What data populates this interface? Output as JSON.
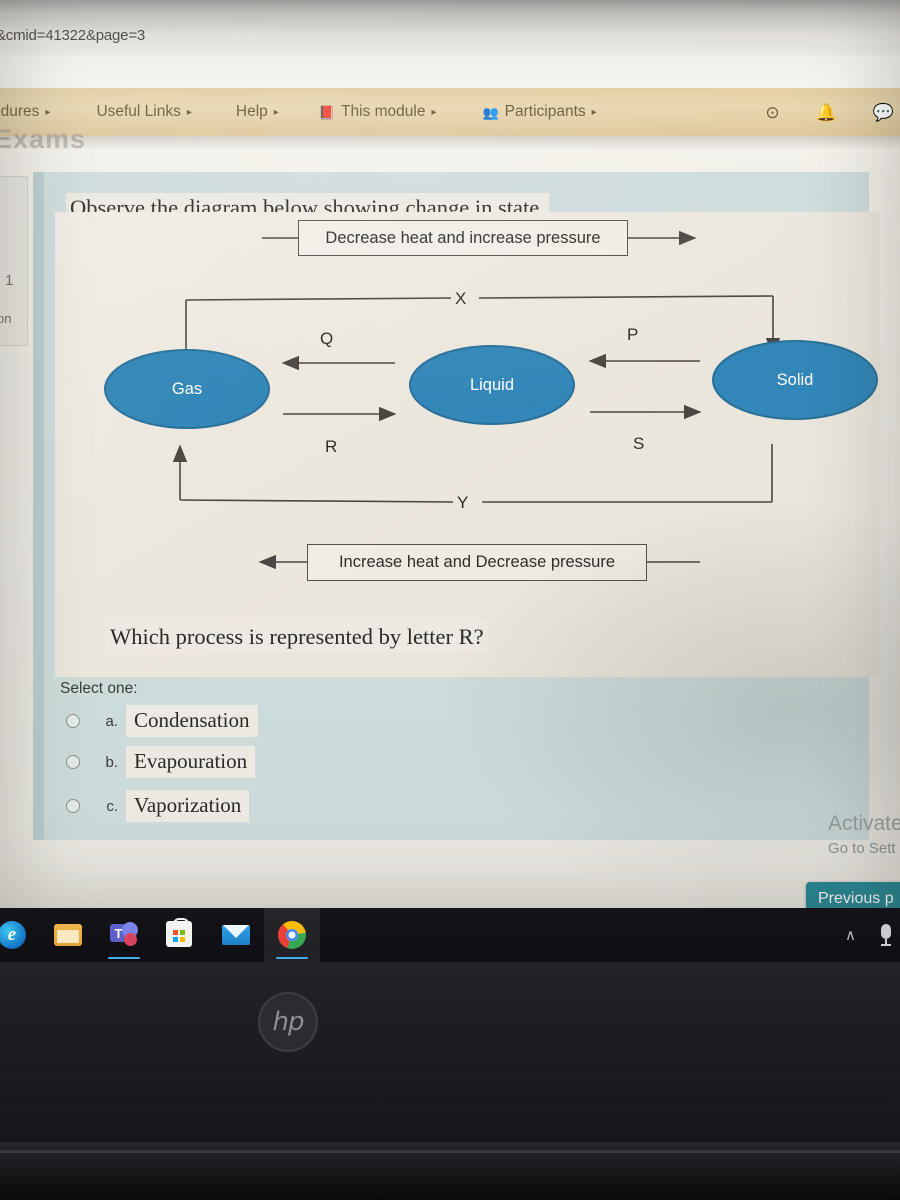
{
  "browser": {
    "url_fragment": "&cmid=41322&page=3"
  },
  "navbar": {
    "items": [
      {
        "label": "edures",
        "caret": "▸",
        "icon": ""
      },
      {
        "label": "Useful Links",
        "caret": "▸",
        "icon": ""
      },
      {
        "label": "Help",
        "caret": "▸",
        "icon": ""
      },
      {
        "label": "This module",
        "caret": "▸",
        "icon": "📕"
      },
      {
        "label": "Participants",
        "caret": "▸",
        "icon": "👥"
      }
    ],
    "right_icons": [
      {
        "name": "download-icon",
        "glyph": "⊙"
      },
      {
        "name": "notifications-bell-icon",
        "glyph": "🔔"
      },
      {
        "name": "messages-icon",
        "glyph": "💬"
      }
    ]
  },
  "breadcrumb_ghost": "Exams",
  "question_nav": {
    "number": "1",
    "status_fragment": "on"
  },
  "quiz": {
    "prompt": "Observe the diagram below showing change in state.",
    "question": "Which process is represented by letter R?",
    "select_label": "Select one:",
    "options": [
      {
        "letter": "a.",
        "text": "Condensation",
        "selected": false
      },
      {
        "letter": "b.",
        "text": "Evapouration",
        "selected": false
      },
      {
        "letter": "c.",
        "text": "Vaporization",
        "selected": false
      }
    ]
  },
  "diagram": {
    "top_box": "Decrease heat and increase pressure",
    "bottom_box": "Increase heat and Decrease pressure",
    "nodes": [
      {
        "label": "Gas"
      },
      {
        "label": "Liquid"
      },
      {
        "label": "Solid"
      }
    ],
    "letters": {
      "x": "X",
      "y": "Y",
      "q": "Q",
      "p": "P",
      "r": "R",
      "s": "S"
    },
    "node_color": "#3287b8",
    "node_border": "#2a7099",
    "line_color": "#4a4744"
  },
  "watermark": {
    "line1": "Activate",
    "line2": "Go to Sett"
  },
  "buttons": {
    "previous_page": "Previous p"
  },
  "taskbar": {
    "items": [
      {
        "name": "edge-icon",
        "active": false,
        "running": false
      },
      {
        "name": "file-explorer-icon",
        "active": false,
        "running": false
      },
      {
        "name": "teams-icon",
        "active": false,
        "running": true
      },
      {
        "name": "microsoft-store-icon",
        "active": false,
        "running": false
      },
      {
        "name": "mail-icon",
        "active": false,
        "running": false
      },
      {
        "name": "chrome-icon",
        "active": true,
        "running": true
      }
    ],
    "tray": [
      {
        "name": "show-hidden-icons-chevron",
        "glyph": "∧"
      },
      {
        "name": "microphone-icon",
        "glyph": ""
      }
    ]
  },
  "device": {
    "brand": "hp"
  }
}
